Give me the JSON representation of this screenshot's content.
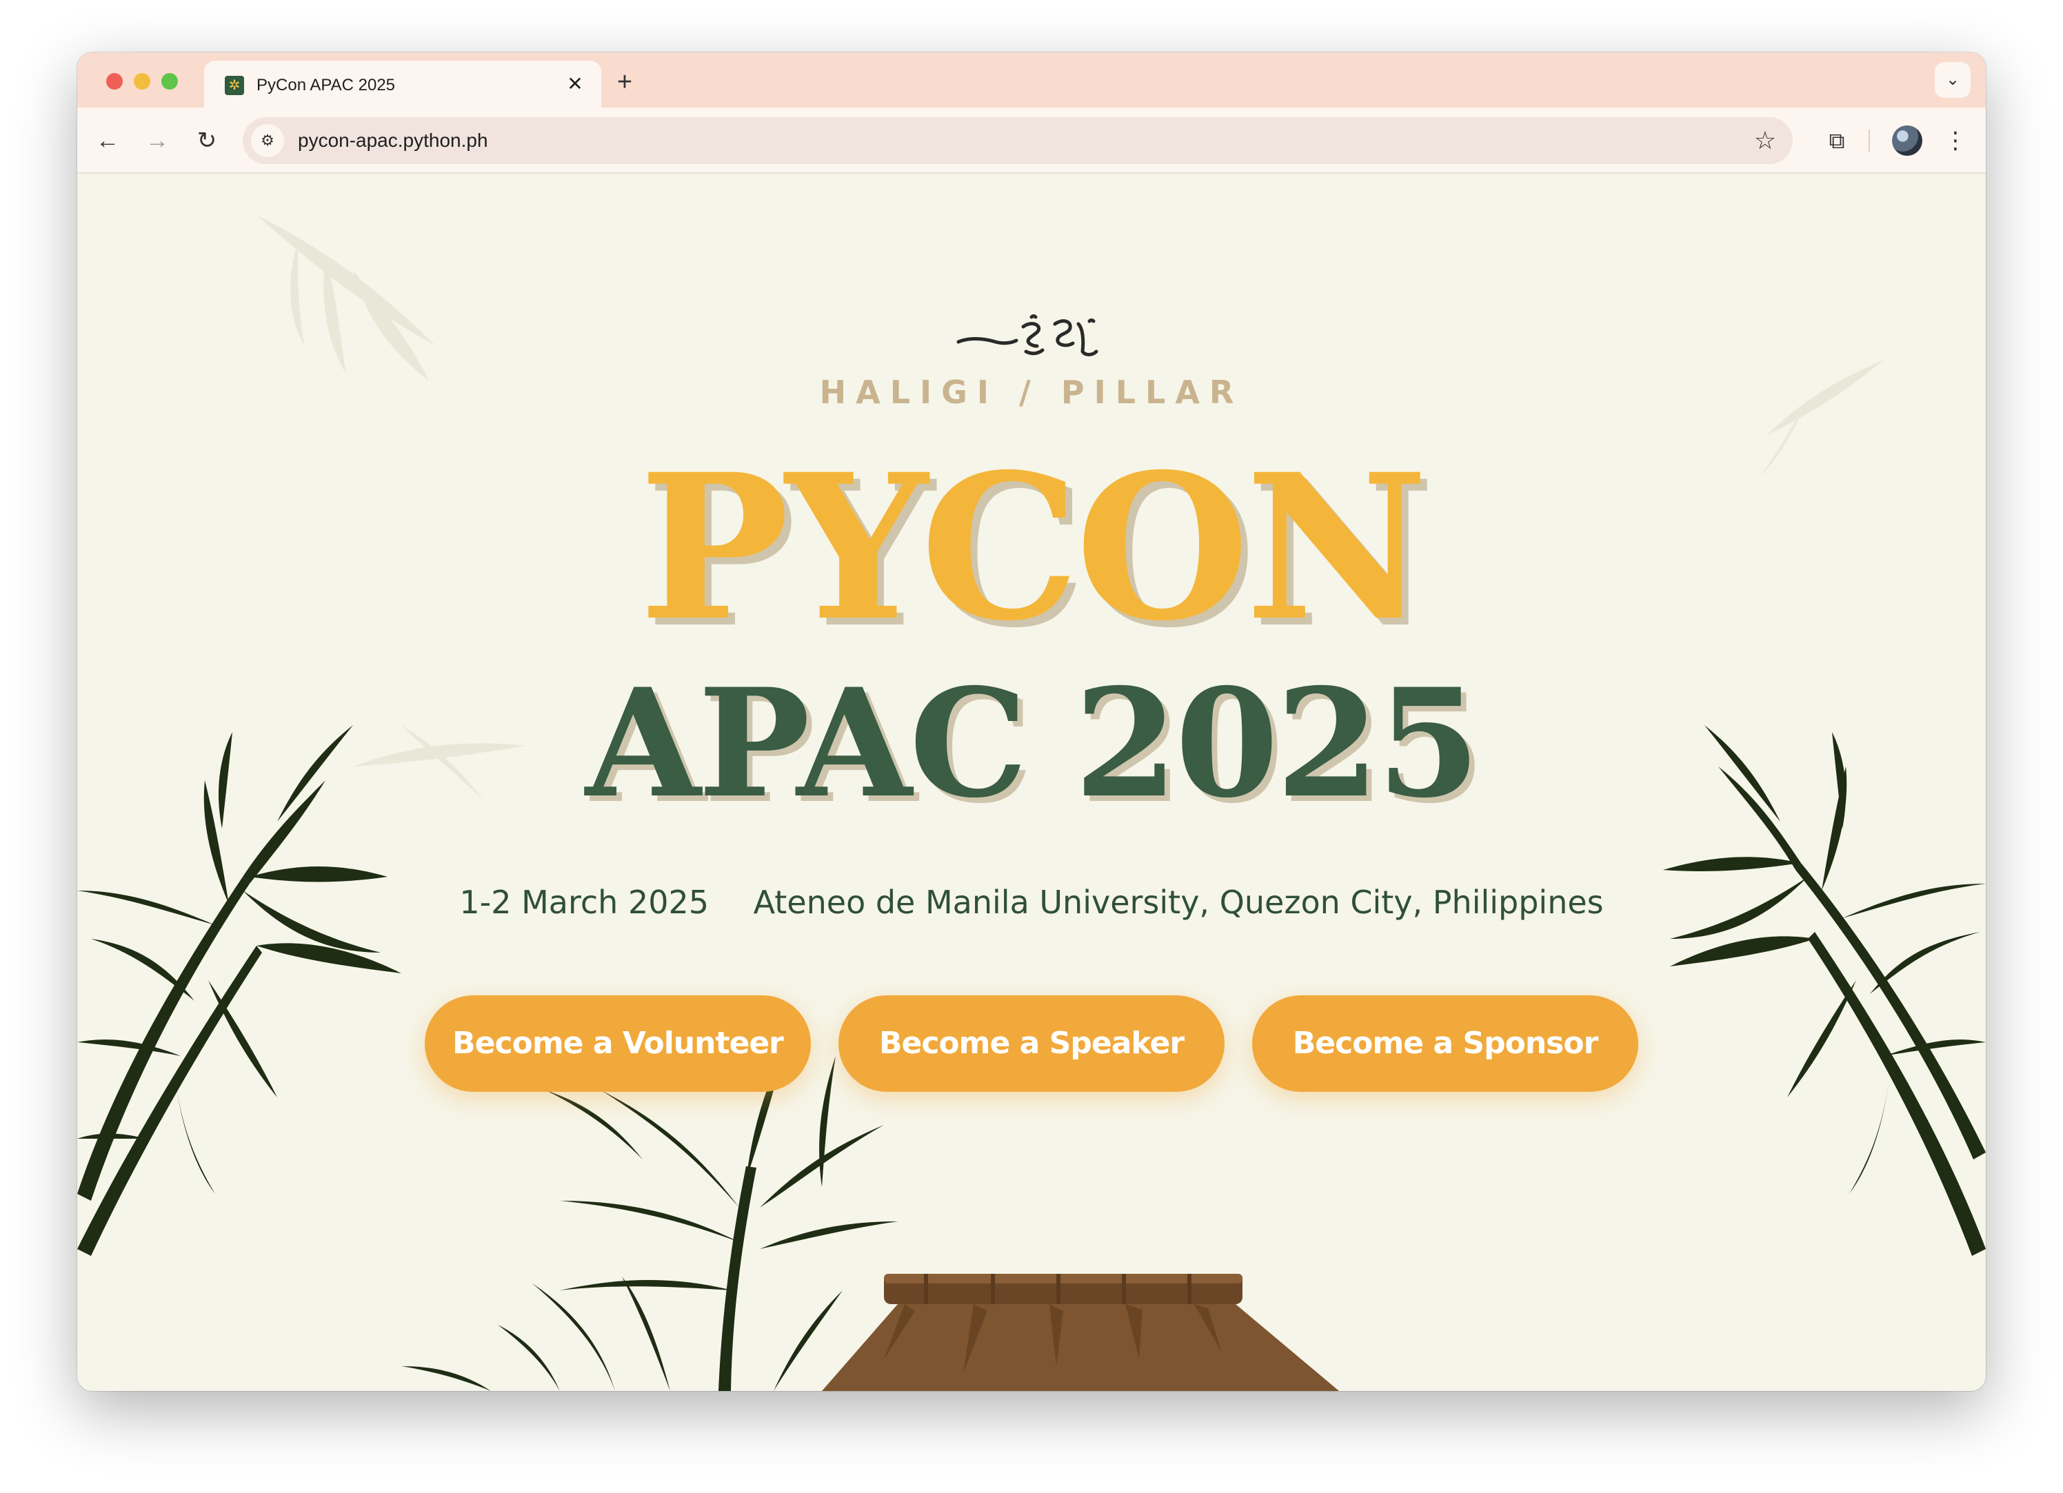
{
  "browser": {
    "tab_title": "PyCon APAC 2025",
    "tab_close": "✕",
    "new_tab": "+",
    "tab_search": "⌄",
    "url": "pycon-apac.python.ph",
    "back": "←",
    "forward": "→",
    "reload": "↻",
    "site_info": "⚙",
    "bookmark": "☆",
    "extensions": "⧉",
    "menu": "⋮"
  },
  "hero": {
    "eyebrow": "HALIGI / PILLAR",
    "title_line1": "PYCON",
    "title_line2": "APAC 2025",
    "date": "1-2 March 2025",
    "venue": "Ateneo de Manila University, Quezon City, Philippines"
  },
  "cta": {
    "volunteer": "Become a Volunteer",
    "speaker": "Become a Speaker",
    "sponsor": "Become a Sponsor"
  },
  "colors": {
    "primary_yellow": "#f4b63a",
    "button_orange": "#f1a93b",
    "forest_green": "#3a5d44",
    "background": "#f6f5e9",
    "bamboo_dark": "#1e2d14",
    "roof_brown": "#7d5530"
  }
}
